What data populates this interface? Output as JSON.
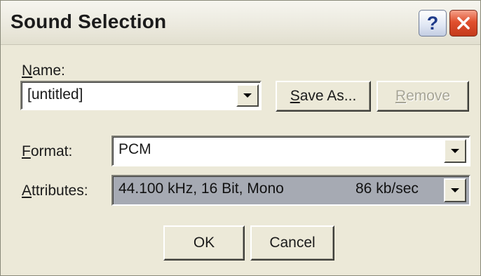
{
  "window": {
    "title": "Sound Selection",
    "help_button_label": "?",
    "close_icon": "close-icon"
  },
  "name_section": {
    "label": "Name:",
    "label_mnemonic": "N",
    "label_rest": "ame:",
    "value": "[untitled]",
    "save_as_label": "Save As...",
    "save_as_mnemonic": "S",
    "save_as_rest": "ave As...",
    "remove_label": "Remove",
    "remove_mnemonic": "R",
    "remove_rest": "emove",
    "remove_enabled": false
  },
  "format": {
    "label": "Format:",
    "label_mnemonic": "F",
    "label_rest": "ormat:",
    "value": "PCM"
  },
  "attributes": {
    "label": "Attributes:",
    "label_mnemonic": "A",
    "label_rest": "ttributes:",
    "value": "44.100 kHz, 16 Bit, Mono",
    "rate": "86 kb/sec"
  },
  "buttons": {
    "ok": "OK",
    "cancel": "Cancel"
  },
  "colors": {
    "dialog_bg": "#ece9d8",
    "close_red": "#e0502e",
    "help_blue": "#1e3a8a",
    "attributes_highlight": "#a6aab3"
  }
}
